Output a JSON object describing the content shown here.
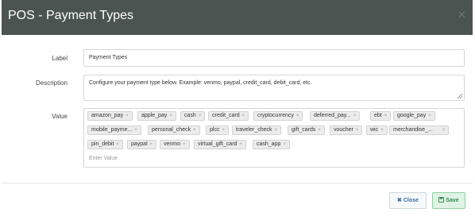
{
  "modal": {
    "title": "POS - Payment Types",
    "close_icon": "close-icon"
  },
  "form": {
    "label_caption": "Label",
    "label_value": "Payment Types",
    "description_caption": "Description",
    "description_value": "Configure your payment type below. Example: venmo, paypal, credit_card, debit_card, etc.",
    "value_caption": "Value",
    "tags": [
      "amazon_pay",
      "apple_pay",
      "cash",
      "credit_card",
      "cryptocurrency",
      "deferred_pay...",
      "ebt",
      "google_pay",
      "mobile_payme...",
      "personal_check",
      "plcc",
      "traveler_check",
      "gift_cards",
      "voucher",
      "wic",
      "merchandise_...",
      "pin_debit",
      "paypal",
      "venmo",
      "virtual_gift_card",
      "cash_app"
    ],
    "tag_remove_symbol": "×",
    "value_placeholder": "Enter Value"
  },
  "footer": {
    "close_label": "Close",
    "save_label": "Save",
    "close_icon": "x-icon",
    "save_icon": "floppy-disk-icon"
  }
}
